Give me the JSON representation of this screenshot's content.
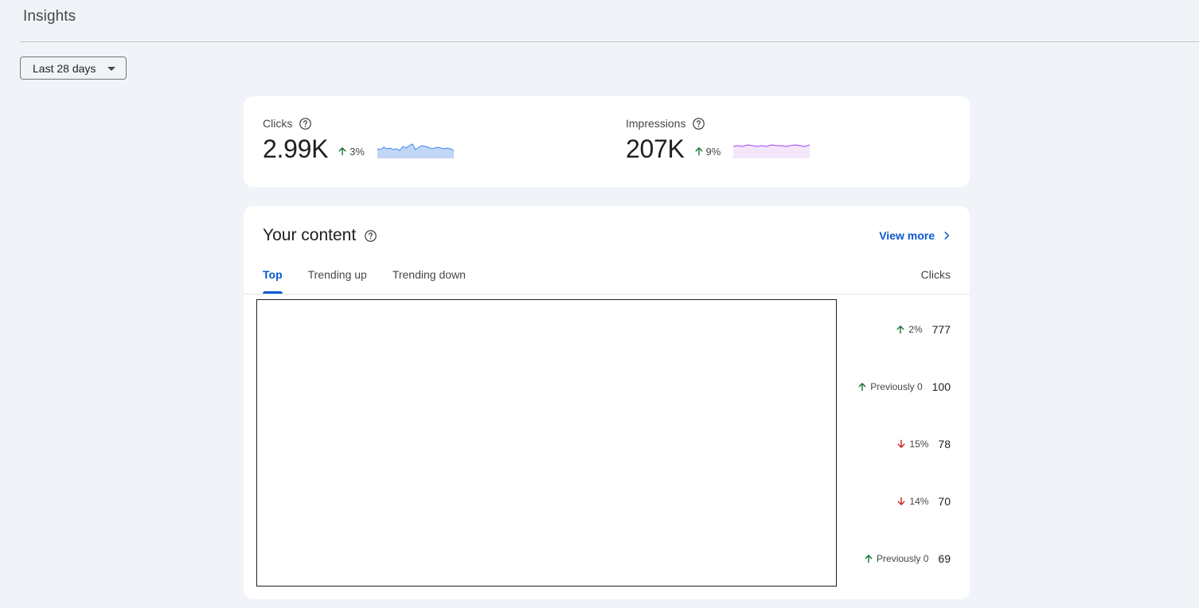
{
  "header": {
    "title": "Insights"
  },
  "date_range": {
    "selected": "Last 28 days"
  },
  "metrics": [
    {
      "label": "Clicks",
      "value": "2.99K",
      "change": "3%",
      "direction": "up",
      "sparkline_color": "#4285f4",
      "sparkline_fill": "#c2d7f6"
    },
    {
      "label": "Impressions",
      "value": "207K",
      "change": "9%",
      "direction": "up",
      "sparkline_color": "#a142f4",
      "sparkline_fill": "#f3e6fb"
    }
  ],
  "content": {
    "title": "Your content",
    "view_more": "View more",
    "tabs": [
      "Top",
      "Trending up",
      "Trending down"
    ],
    "active_tab": "Top",
    "column_header": "Clicks",
    "rows": [
      {
        "change": "2%",
        "direction": "up",
        "clicks": "777"
      },
      {
        "change": "Previously 0",
        "direction": "up",
        "clicks": "100"
      },
      {
        "change": "15%",
        "direction": "down",
        "clicks": "78"
      },
      {
        "change": "14%",
        "direction": "down",
        "clicks": "70"
      },
      {
        "change": "Previously 0",
        "direction": "up",
        "clicks": "69"
      }
    ]
  },
  "colors": {
    "accent": "#0b57d0",
    "up": "#137333",
    "down": "#c5221f",
    "background": "#f0f4f9"
  },
  "icons": {
    "help": "help-circle-icon",
    "up": "arrow-up-icon",
    "down": "arrow-down-icon",
    "dropdown": "caret-down-icon",
    "view_more": "chevron-right-icon"
  }
}
